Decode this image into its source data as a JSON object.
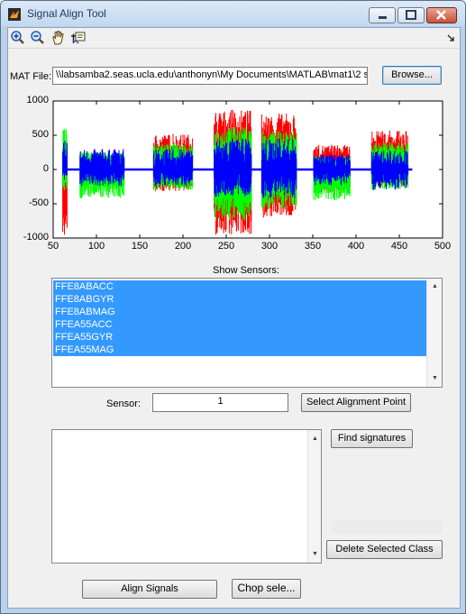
{
  "window": {
    "title": "Signal Align Tool",
    "icon": "matlab-figure-icon",
    "controls": [
      "minimize-icon",
      "maximize-icon",
      "close-icon"
    ]
  },
  "toolbar": {
    "icons": [
      "zoom-in-icon",
      "zoom-out-icon",
      "pan-hand-icon",
      "data-cursor-icon"
    ]
  },
  "mat_file": {
    "label": "MAT File:",
    "value": "\\\\labsamba2.seas.ucla.edu\\anthonyn\\My Documents\\MATLAB\\mat1\\2 se",
    "browse_label": "Browse..."
  },
  "chart_data": {
    "type": "line",
    "x_ticks": [
      "50",
      "100",
      "150",
      "200",
      "250",
      "300",
      "350",
      "400",
      "450",
      "500"
    ],
    "y_ticks": [
      "1000",
      "500",
      "0",
      "-500",
      "-1000"
    ],
    "xlim": [
      50,
      500
    ],
    "ylim": [
      -1000,
      1000
    ],
    "series_colors": [
      "#ff0000",
      "#00ff00",
      "#0000ff"
    ],
    "bursts": [
      {
        "start": 61,
        "end": 66,
        "red": [
          -950,
          400
        ],
        "green": [
          -300,
          600
        ],
        "blue": [
          -150,
          420
        ]
      },
      {
        "start": 81,
        "end": 132,
        "red": [
          -220,
          180
        ],
        "green": [
          -420,
          260
        ],
        "blue": [
          -240,
          300
        ]
      },
      {
        "start": 166,
        "end": 211,
        "red": [
          -320,
          520
        ],
        "green": [
          -300,
          380
        ],
        "blue": [
          -240,
          300
        ]
      },
      {
        "start": 236,
        "end": 279,
        "red": [
          -950,
          870
        ],
        "green": [
          -750,
          620
        ],
        "blue": [
          -400,
          450
        ]
      },
      {
        "start": 291,
        "end": 331,
        "red": [
          -700,
          820
        ],
        "green": [
          -580,
          560
        ],
        "blue": [
          -420,
          450
        ]
      },
      {
        "start": 351,
        "end": 393,
        "red": [
          -330,
          360
        ],
        "green": [
          -450,
          200
        ],
        "blue": [
          -230,
          220
        ]
      },
      {
        "start": 418,
        "end": 460,
        "red": [
          -250,
          570
        ],
        "green": [
          -300,
          400
        ],
        "blue": [
          -300,
          280
        ]
      }
    ]
  },
  "sensors": {
    "label": "Show Sensors:",
    "items": [
      "FFE8ABACC",
      "FFE8ABGYR",
      "FFE8ABMAG",
      "FFEA55ACC",
      "FFEA55GYR",
      "FFEA55MAG"
    ],
    "selection_color": "#3399ff"
  },
  "sensor_field": {
    "label": "Sensor:",
    "value": "1",
    "button_label": "Select Alignment Point"
  },
  "signatures": {
    "find_label": "Find signatures",
    "delete_label": "Delete Selected Class"
  },
  "bottom": {
    "align_label": "Align Signals",
    "chop_label": "Chop sele..."
  }
}
